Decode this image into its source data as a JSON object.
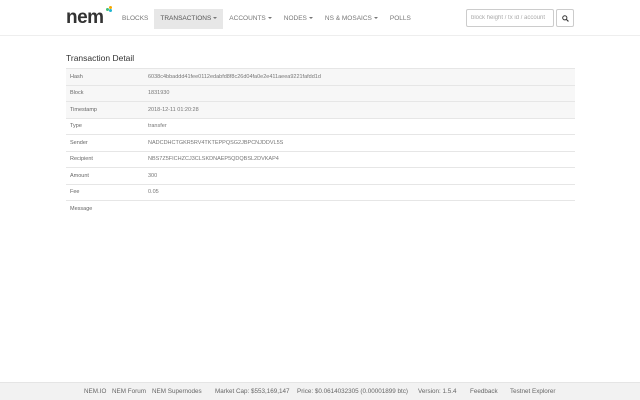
{
  "brand": {
    "name": "nem",
    "colors": [
      "#41bf76",
      "#f7a800",
      "#20b5d0"
    ]
  },
  "nav": {
    "items": [
      {
        "label": "BLOCKS",
        "dropdown": false,
        "active": false
      },
      {
        "label": "TRANSACTIONS",
        "dropdown": true,
        "active": true
      },
      {
        "label": "ACCOUNTS",
        "dropdown": true,
        "active": false
      },
      {
        "label": "NODES",
        "dropdown": true,
        "active": false
      },
      {
        "label": "NS & MOSAICS",
        "dropdown": true,
        "active": false
      },
      {
        "label": "POLLS",
        "dropdown": false,
        "active": false
      }
    ]
  },
  "search": {
    "placeholder": "block height / tx id / account",
    "icon": "search-icon"
  },
  "detail": {
    "title": "Transaction Detail",
    "rows": [
      {
        "key": "Hash",
        "value": "6038c4bbaddd41fee0112edabfd8f8c26d04fa0e2e411aeea9221fafdd1d"
      },
      {
        "key": "Block",
        "value": "1831930"
      },
      {
        "key": "Timestamp",
        "value": "2018-12-11 01:20:28"
      },
      {
        "key": "Type",
        "value": "transfer"
      },
      {
        "key": "Sender",
        "value": "NADCDHCTGKR5RV4TKTEPPQSG2JBPCNJDDVL5S"
      },
      {
        "key": "Recipient",
        "value": "NBS7Z5FICHZCJ3CLSKDNAEP5QDQBSL2DVKAP4"
      },
      {
        "key": "Amount",
        "value": "300"
      },
      {
        "key": "Fee",
        "value": "0.05"
      },
      {
        "key": "Message",
        "value": ""
      }
    ]
  },
  "footer": {
    "links": [
      "NEM.IO",
      "NEM Forum",
      "NEM Supernodes",
      "Market Cap: $553,169,147",
      "Price: $0.0614032305 (0.00001899 btc)",
      "Version: 1.5.4",
      "Feedback",
      "Testnet Explorer"
    ]
  }
}
